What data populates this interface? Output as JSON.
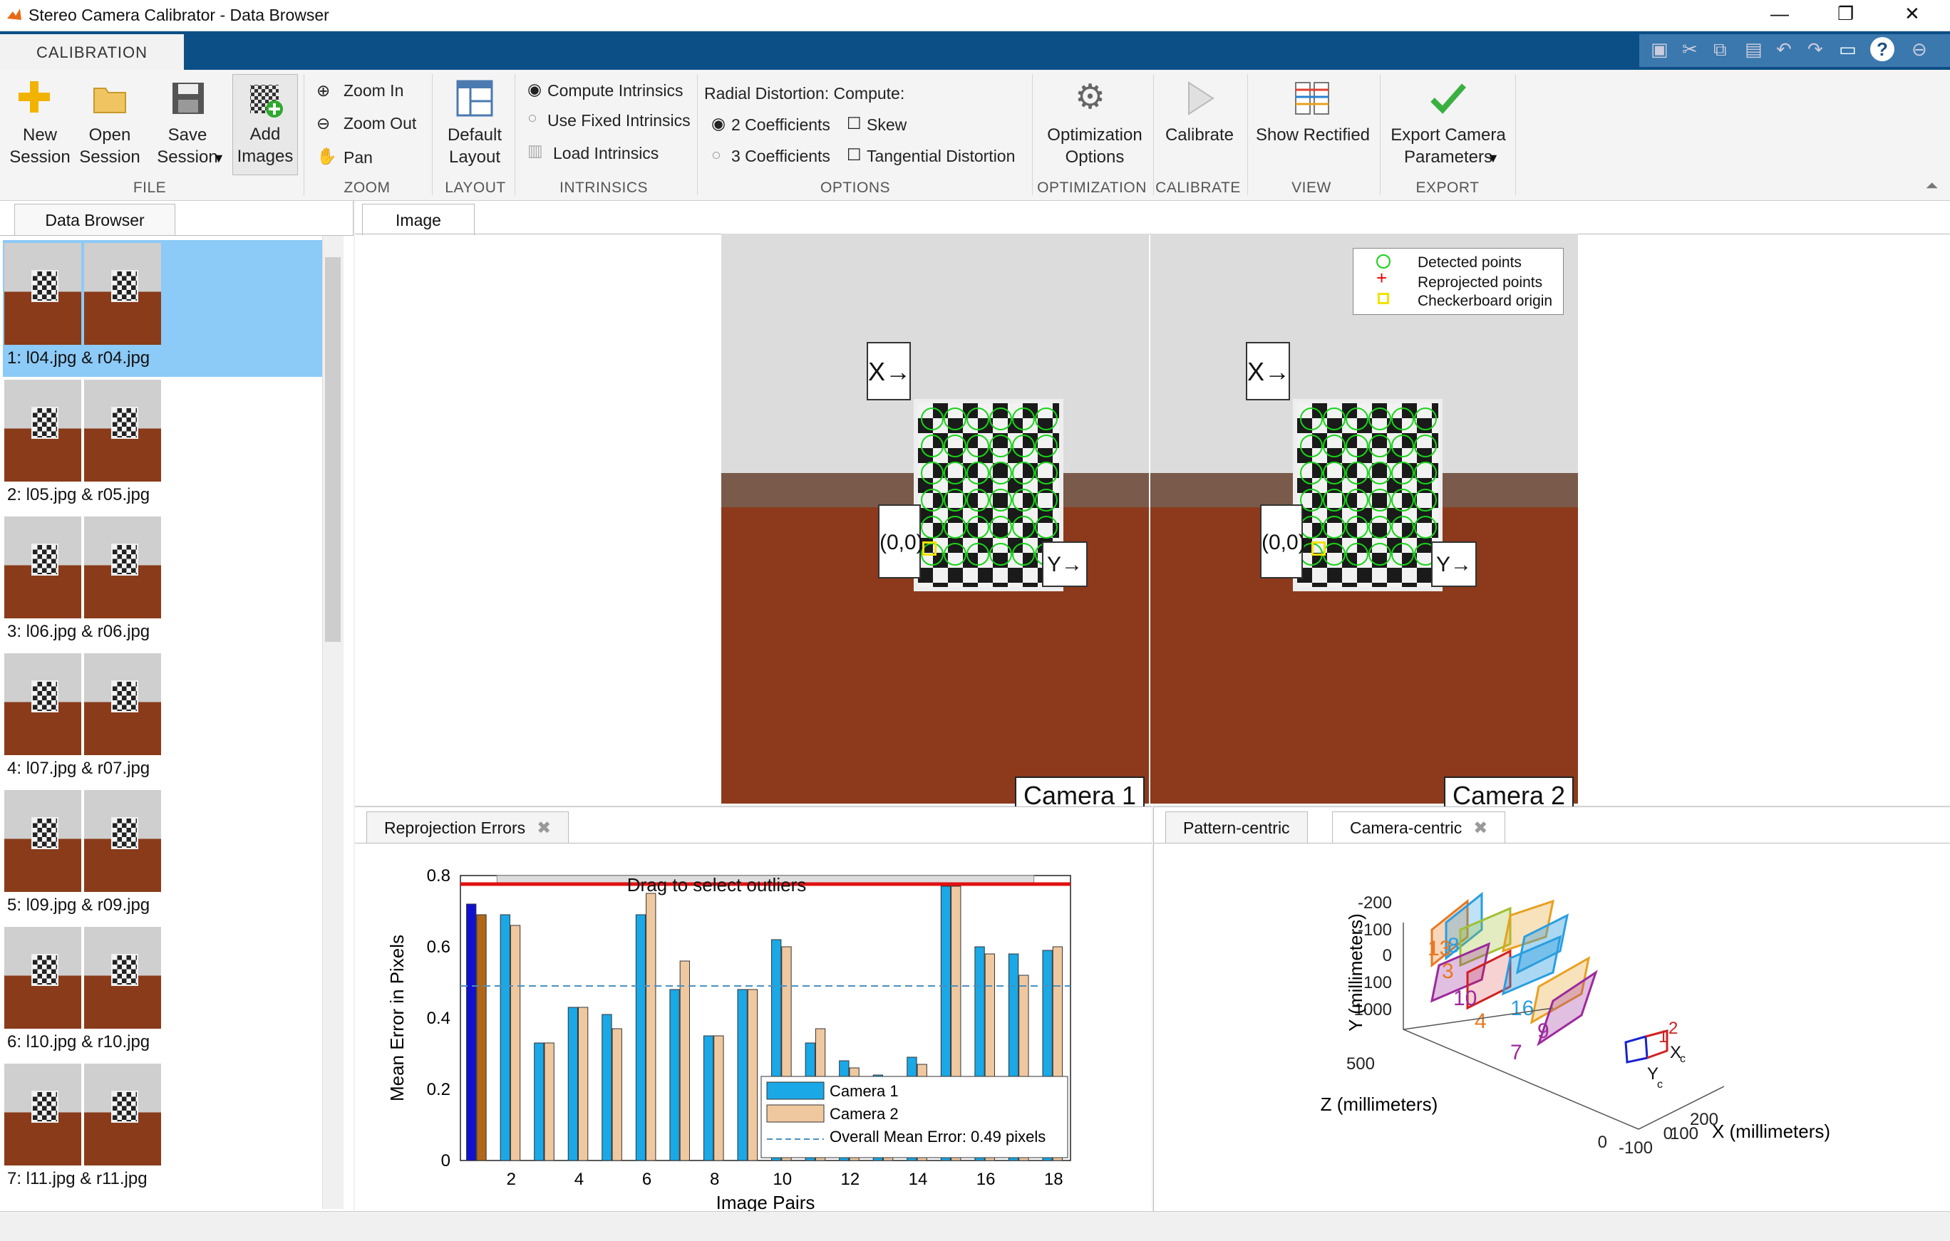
{
  "window": {
    "title": "Stereo Camera Calibrator - Data Browser",
    "minimize": "—",
    "maximize": "❐",
    "close": "✕"
  },
  "tabs": {
    "calibration": "CALIBRATION"
  },
  "ribbon": {
    "file": {
      "group": "FILE",
      "new": "New\nSession",
      "open": "Open\nSession",
      "save": "Save\nSession",
      "add": "Add\nImages"
    },
    "zoom": {
      "group": "ZOOM",
      "zoom_in": "Zoom In",
      "zoom_out": "Zoom Out",
      "pan": "Pan"
    },
    "layout": {
      "group": "LAYOUT",
      "default": "Default\nLayout"
    },
    "intrinsics": {
      "group": "INTRINSICS",
      "compute": "Compute Intrinsics",
      "fixed": "Use Fixed Intrinsics",
      "load": "Load Intrinsics"
    },
    "options": {
      "group": "OPTIONS",
      "radial": "Radial Distortion: Compute:",
      "two": "2 Coefficients",
      "three": "3 Coefficients",
      "skew": "Skew",
      "tangential": "Tangential Distortion"
    },
    "optimization": {
      "group": "OPTIMIZATION",
      "label": "Optimization\nOptions"
    },
    "calibrate": {
      "group": "CALIBRATE",
      "label": "Calibrate"
    },
    "view": {
      "group": "VIEW",
      "label": "Show Rectified"
    },
    "export": {
      "group": "EXPORT",
      "label": "Export Camera\nParameters"
    }
  },
  "browser": {
    "tab": "Data Browser",
    "items": [
      "1: l04.jpg & r04.jpg",
      "2: l05.jpg & r05.jpg",
      "3: l06.jpg & r06.jpg",
      "4: l07.jpg & r07.jpg",
      "5: l09.jpg & r09.jpg",
      "6: l10.jpg & r10.jpg",
      "7: l11.jpg & r11.jpg"
    ]
  },
  "image": {
    "tab": "Image",
    "camera1": "Camera 1",
    "camera2": "Camera 2",
    "origin": "(0,0)",
    "x_arrow": "X→",
    "y_arrow": "Y→",
    "legend": [
      "Detected points",
      "Reprojected points",
      "Checkerboard origin"
    ]
  },
  "reproj": {
    "tab": "Reprojection Errors",
    "drag": "Drag to select outliers",
    "ylabel": "Mean Error in Pixels",
    "xlabel": "Image Pairs",
    "legend": [
      "Camera 1",
      "Camera 2",
      "Overall Mean Error: 0.49 pixels"
    ]
  },
  "chart_data": {
    "type": "bar",
    "ylabel": "Mean Error in Pixels",
    "xlabel": "Image Pairs",
    "ylim": [
      0,
      0.8
    ],
    "categories": [
      1,
      2,
      3,
      4,
      5,
      6,
      7,
      8,
      9,
      10,
      11,
      12,
      13,
      14,
      15,
      16,
      17,
      18
    ],
    "series": [
      {
        "name": "Camera 1",
        "color": "#1aa8e6",
        "values": [
          0.72,
          0.69,
          0.33,
          0.43,
          0.41,
          0.69,
          0.48,
          0.35,
          0.48,
          0.62,
          0.33,
          0.28,
          0.24,
          0.29,
          0.77,
          0.6,
          0.58,
          0.59
        ]
      },
      {
        "name": "Camera 2",
        "color": "#f0c8a0",
        "values": [
          0.69,
          0.66,
          0.33,
          0.43,
          0.37,
          0.75,
          0.56,
          0.35,
          0.48,
          0.6,
          0.37,
          0.26,
          0.22,
          0.27,
          0.77,
          0.58,
          0.52,
          0.6
        ]
      }
    ],
    "mean": 0.49,
    "xticks": [
      2,
      4,
      6,
      8,
      10,
      12,
      14,
      16,
      18
    ],
    "yticks": [
      0,
      0.2,
      0.4,
      0.6,
      0.8
    ],
    "legend": "bottom-right",
    "selected": 1
  },
  "camview": {
    "tab1": "Pattern-centric",
    "tab2": "Camera-centric",
    "ylabel": "Y (millimeters)",
    "zlabel": "Z (millimeters)",
    "xlabel": "X (millimeters)",
    "yticks": [
      "-200",
      "-100",
      "0",
      "100",
      "1000"
    ],
    "zticks": [
      "500",
      "0"
    ],
    "xticks": [
      "-100",
      "0",
      "100",
      "200"
    ],
    "labels": [
      "13",
      "8",
      "3",
      "10",
      "4",
      "16",
      "7",
      "9"
    ],
    "cam_labels": [
      "1",
      "2",
      "X",
      "Y",
      "c",
      "c"
    ]
  }
}
